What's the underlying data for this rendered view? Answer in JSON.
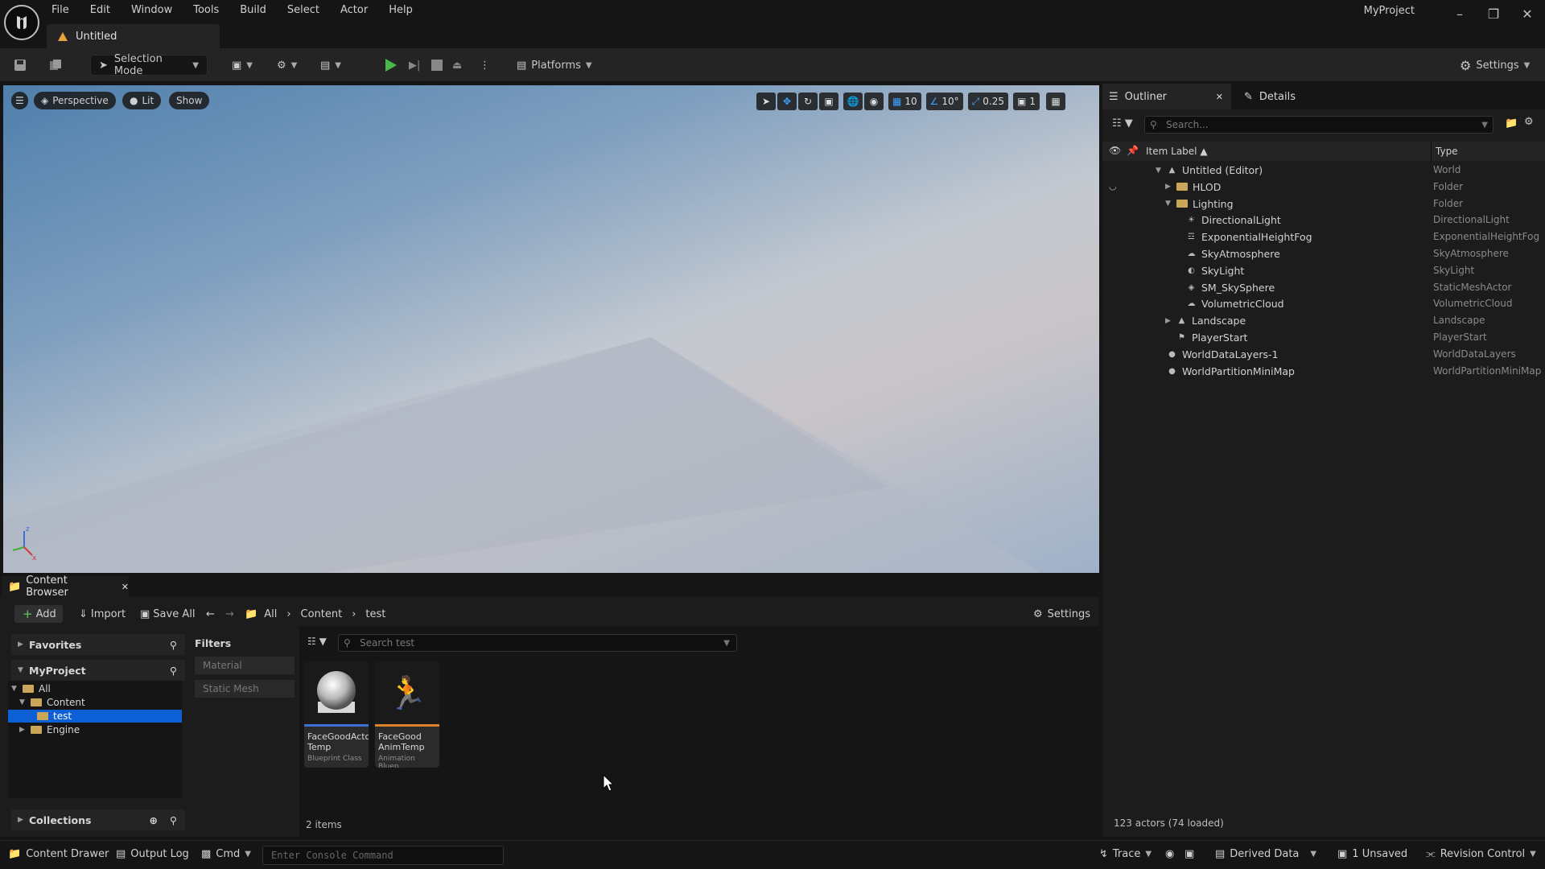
{
  "menu": [
    "File",
    "Edit",
    "Window",
    "Tools",
    "Build",
    "Select",
    "Actor",
    "Help"
  ],
  "project_name": "MyProject",
  "level_tab": "Untitled",
  "toolbar": {
    "selection_mode": "Selection Mode",
    "platforms": "Platforms",
    "settings": "Settings"
  },
  "viewport": {
    "perspective": "Perspective",
    "lit": "Lit",
    "show": "Show",
    "grid_snap": "10",
    "rot_snap": "10°",
    "scale_snap": "0.25",
    "camera_speed": "1"
  },
  "outliner": {
    "tab_outliner": "Outliner",
    "tab_details": "Details",
    "search_placeholder": "Search...",
    "col_label": "Item Label ▲",
    "col_type": "Type",
    "rows": [
      {
        "label": "Untitled (Editor)",
        "type": "World",
        "icon": "world-icon"
      },
      {
        "label": "HLOD",
        "type": "Folder",
        "icon": "folder-icon"
      },
      {
        "label": "Lighting",
        "type": "Folder",
        "icon": "folder-icon"
      },
      {
        "label": "DirectionalLight",
        "type": "DirectionalLight",
        "icon": "sun-icon"
      },
      {
        "label": "ExponentialHeightFog",
        "type": "ExponentialHeightFog",
        "icon": "fog-icon"
      },
      {
        "label": "SkyAtmosphere",
        "type": "SkyAtmosphere",
        "icon": "atmosphere-icon"
      },
      {
        "label": "SkyLight",
        "type": "SkyLight",
        "icon": "skylight-icon"
      },
      {
        "label": "SM_SkySphere",
        "type": "StaticMeshActor",
        "icon": "mesh-icon"
      },
      {
        "label": "VolumetricCloud",
        "type": "VolumetricCloud",
        "icon": "cloud-icon"
      },
      {
        "label": "Landscape",
        "type": "Landscape",
        "icon": "landscape-icon"
      },
      {
        "label": "PlayerStart",
        "type": "PlayerStart",
        "icon": "playerstart-icon"
      },
      {
        "label": "WorldDataLayers-1",
        "type": "WorldDataLayers",
        "icon": "sphere-icon"
      },
      {
        "label": "WorldPartitionMiniMap",
        "type": "WorldPartitionMiniMap",
        "icon": "sphere-icon"
      }
    ],
    "actors_count": "123 actors (74 loaded)"
  },
  "content_browser": {
    "tab": "Content Browser",
    "add": "Add",
    "import": "Import",
    "save_all": "Save All",
    "crumbs": [
      "All",
      "Content",
      "test"
    ],
    "settings": "Settings",
    "favorites": "Favorites",
    "project": "MyProject",
    "tree": [
      "All",
      "Content",
      "test",
      "Engine"
    ],
    "collections": "Collections",
    "filters_title": "Filters",
    "filters": [
      "Material",
      "Static Mesh"
    ],
    "search_placeholder": "Search test",
    "assets": [
      {
        "name": "FaceGoodActor Temp",
        "class": "Blueprint Class",
        "accent": "#3d6fd6"
      },
      {
        "name": "FaceGood AnimTemp",
        "class": "Animation Bluep...",
        "accent": "#d9822b"
      }
    ],
    "items_count": "2 items"
  },
  "statusbar": {
    "content_drawer": "Content Drawer",
    "output_log": "Output Log",
    "cmd": "Cmd",
    "console_placeholder": "Enter Console Command",
    "trace": "Trace",
    "derived_data": "Derived Data",
    "unsaved": "1 Unsaved",
    "revision_control": "Revision Control"
  }
}
